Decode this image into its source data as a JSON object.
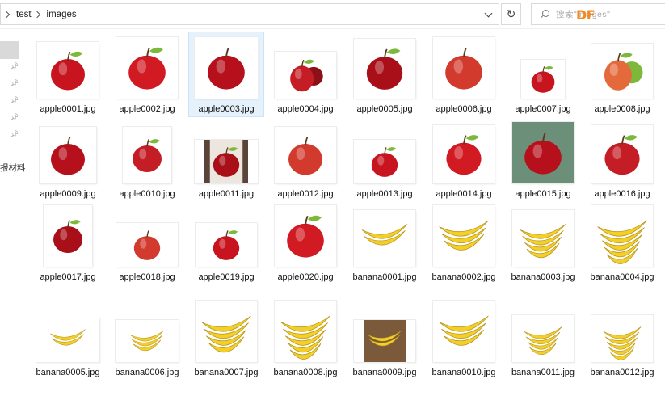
{
  "breadcrumb": {
    "items": [
      "test",
      "images"
    ]
  },
  "search": {
    "placeholder": "搜索\"images\""
  },
  "watermark": "DF",
  "sidebar": {
    "visible_text": "报材料"
  },
  "files": [
    {
      "name": "apple0001.jpg",
      "kind": "apple"
    },
    {
      "name": "apple0002.jpg",
      "kind": "apple"
    },
    {
      "name": "apple0003.jpg",
      "kind": "apple",
      "selected": true
    },
    {
      "name": "apple0004.jpg",
      "kind": "apple"
    },
    {
      "name": "apple0005.jpg",
      "kind": "apple"
    },
    {
      "name": "apple0006.jpg",
      "kind": "apple"
    },
    {
      "name": "apple0007.jpg",
      "kind": "apple"
    },
    {
      "name": "apple0008.jpg",
      "kind": "apple"
    },
    {
      "name": "apple0009.jpg",
      "kind": "apple"
    },
    {
      "name": "apple0010.jpg",
      "kind": "apple"
    },
    {
      "name": "apple0011.jpg",
      "kind": "apple"
    },
    {
      "name": "apple0012.jpg",
      "kind": "apple"
    },
    {
      "name": "apple0013.jpg",
      "kind": "apple"
    },
    {
      "name": "apple0014.jpg",
      "kind": "apple"
    },
    {
      "name": "apple0015.jpg",
      "kind": "apple"
    },
    {
      "name": "apple0016.jpg",
      "kind": "apple"
    },
    {
      "name": "apple0017.jpg",
      "kind": "apple"
    },
    {
      "name": "apple0018.jpg",
      "kind": "apple"
    },
    {
      "name": "apple0019.jpg",
      "kind": "apple"
    },
    {
      "name": "apple0020.jpg",
      "kind": "apple"
    },
    {
      "name": "banana0001.jpg",
      "kind": "banana"
    },
    {
      "name": "banana0002.jpg",
      "kind": "banana"
    },
    {
      "name": "banana0003.jpg",
      "kind": "banana"
    },
    {
      "name": "banana0004.jpg",
      "kind": "banana"
    },
    {
      "name": "banana0005.jpg",
      "kind": "banana"
    },
    {
      "name": "banana0006.jpg",
      "kind": "banana"
    },
    {
      "name": "banana0007.jpg",
      "kind": "banana"
    },
    {
      "name": "banana0008.jpg",
      "kind": "banana"
    },
    {
      "name": "banana0009.jpg",
      "kind": "banana"
    },
    {
      "name": "banana0010.jpg",
      "kind": "banana"
    },
    {
      "name": "banana0011.jpg",
      "kind": "banana"
    },
    {
      "name": "banana0012.jpg",
      "kind": "banana"
    }
  ],
  "colors": {
    "apple_red": "#c8141e",
    "apple_green": "#7cb83a",
    "banana_yellow": "#f3cf2a",
    "selection": "#e5f1fb"
  }
}
